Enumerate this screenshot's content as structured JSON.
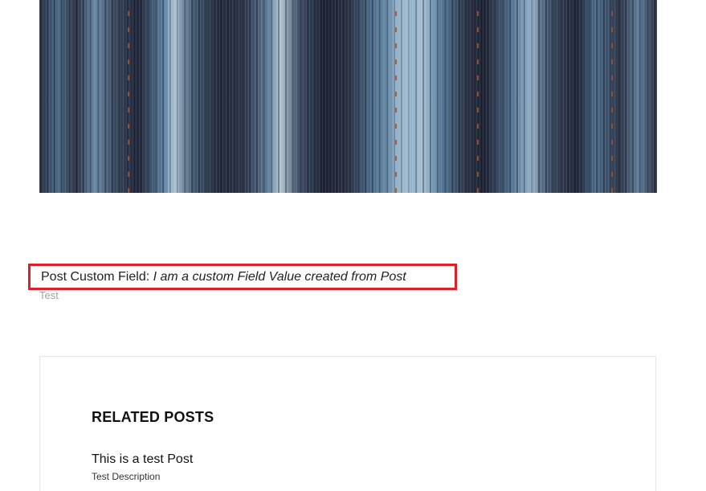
{
  "featured_image": {
    "description_icon": "wood-texture-image"
  },
  "custom_field": {
    "label": "Post Custom Field:",
    "value": "I am a custom Field Value created from Post",
    "highlight_color": "#e02028"
  },
  "tag": {
    "label": "Test"
  },
  "related": {
    "heading": "RELATED POSTS",
    "posts": [
      {
        "title": "This is a test Post",
        "description": "Test Description"
      }
    ]
  }
}
